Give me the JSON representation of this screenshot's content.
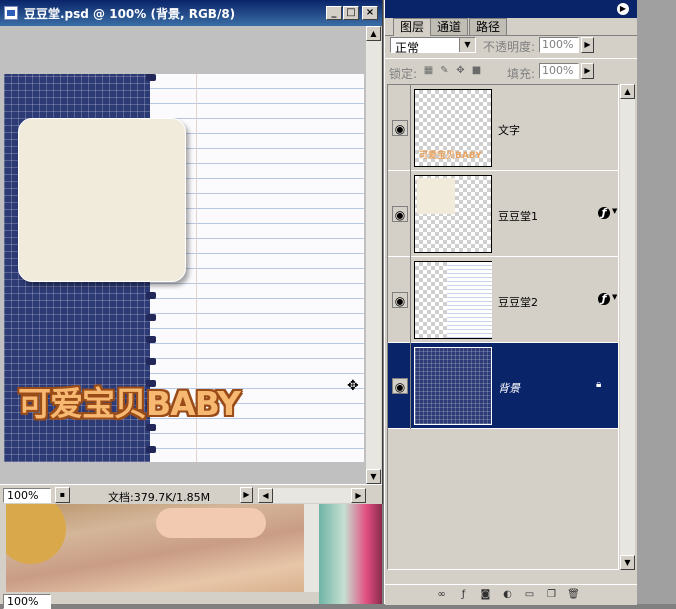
{
  "doc_window": {
    "title": "豆豆堂.psd @ 100% (背景, RGB/8)",
    "zoom": "100%",
    "status": "文档:379.7K/1.85M",
    "art_text": "可爱宝贝BABY",
    "caption_buttons": {
      "minimize": "_",
      "maximize": "□",
      "close": "×"
    }
  },
  "photo_window": {
    "zoom": "100%"
  },
  "layers_panel": {
    "tabs": [
      {
        "label": "图层",
        "active": true
      },
      {
        "label": "通道",
        "active": false
      },
      {
        "label": "路径",
        "active": false
      }
    ],
    "blend_mode": "正常",
    "opacity_label": "不透明度:",
    "opacity_value": "100%",
    "lock_label": "锁定:",
    "fill_label": "填充:",
    "fill_value": "100%",
    "thumb_caption": "可爱宝贝BABY",
    "layers": [
      {
        "name": "文字",
        "selected": false,
        "effects": false,
        "locked": false
      },
      {
        "name": "豆豆堂1",
        "selected": false,
        "effects": true,
        "locked": false
      },
      {
        "name": "豆豆堂2",
        "selected": false,
        "effects": true,
        "locked": false
      },
      {
        "name": "背景",
        "selected": true,
        "effects": false,
        "locked": true
      }
    ],
    "footer_icons": [
      "link-icon",
      "fx-icon",
      "mask-icon",
      "adjustment-icon",
      "folder-icon",
      "new-layer-icon",
      "trash-icon"
    ]
  },
  "colors": {
    "title_bar": "#0a246a",
    "selected_layer": "#0a246a",
    "art_navy": "#2c3a75",
    "art_cream": "#f1ebdc",
    "art_text": "#f7b872"
  }
}
